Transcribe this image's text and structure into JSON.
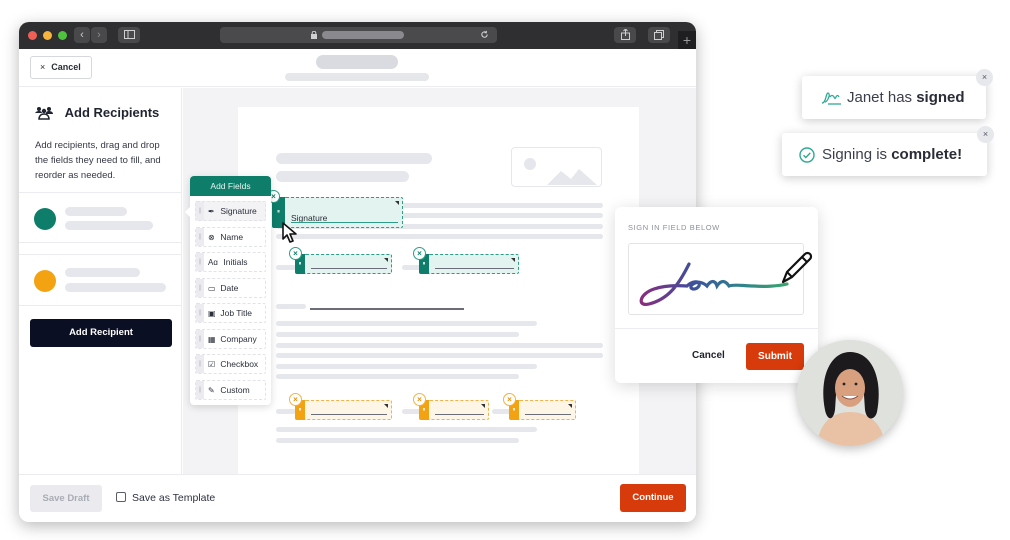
{
  "browser": {
    "traffic_lights": [
      "#ee5f56",
      "#f6b33d",
      "#4fc23f"
    ],
    "nav_back_icon": "chevron-left-icon",
    "nav_forward_icon": "chevron-right-icon",
    "sidebar_toggle_icon": "sidebar-icon",
    "lock_icon": "lock-icon",
    "reload_icon": "reload-icon",
    "share_icon": "share-icon",
    "tabs_icon": "tabs-icon",
    "new_tab_label": "+"
  },
  "header": {
    "cancel_icon": "×",
    "cancel_label": "Cancel"
  },
  "sidebar": {
    "title": "Add Recipients",
    "title_icon": "people-icon",
    "description": "Add recipients, drag and drop the fields they need to fill, and reorder as needed.",
    "recipients": [
      {
        "color": "#0e7d6a"
      },
      {
        "color": "#f3a212"
      }
    ],
    "add_recipient_label": "Add Recipient"
  },
  "fields_panel": {
    "title": "Add Fields",
    "items": [
      {
        "icon": "✒",
        "icon_name": "pen-nib-icon",
        "label": "Signature"
      },
      {
        "icon": "⊗",
        "icon_name": "user-circle-icon",
        "label": "Name"
      },
      {
        "icon": "Aɑ",
        "icon_name": "initials-icon",
        "label": "Initials"
      },
      {
        "icon": "▭",
        "icon_name": "calendar-icon",
        "label": "Date"
      },
      {
        "icon": "▣",
        "icon_name": "id-badge-icon",
        "label": "Job Title"
      },
      {
        "icon": "▦",
        "icon_name": "building-icon",
        "label": "Company"
      },
      {
        "icon": "☑",
        "icon_name": "checkbox-icon",
        "label": "Checkbox"
      },
      {
        "icon": "✎",
        "icon_name": "pencil-icon",
        "label": "Custom"
      }
    ]
  },
  "document": {
    "signature_field_label": "Signature"
  },
  "footer": {
    "save_draft_label": "Save Draft",
    "save_template_label": "Save as Template",
    "save_template_checked": false,
    "continue_label": "Continue"
  },
  "sign_dialog": {
    "label": "SIGN IN FIELD BELOW",
    "cancel_label": "Cancel",
    "submit_label": "Submit"
  },
  "toasts": [
    {
      "icon": "signature-icon",
      "text_prefix": "Janet has ",
      "text_bold": "signed",
      "close": "×"
    },
    {
      "icon": "check-circle-icon",
      "text_prefix": "Signing is ",
      "text_bold": "complete!",
      "close": "×"
    }
  ],
  "colors": {
    "teal": "#0e7d6a",
    "amber": "#f3a212",
    "primary_action": "#d83b0b",
    "dark_button": "#0b0f24"
  }
}
